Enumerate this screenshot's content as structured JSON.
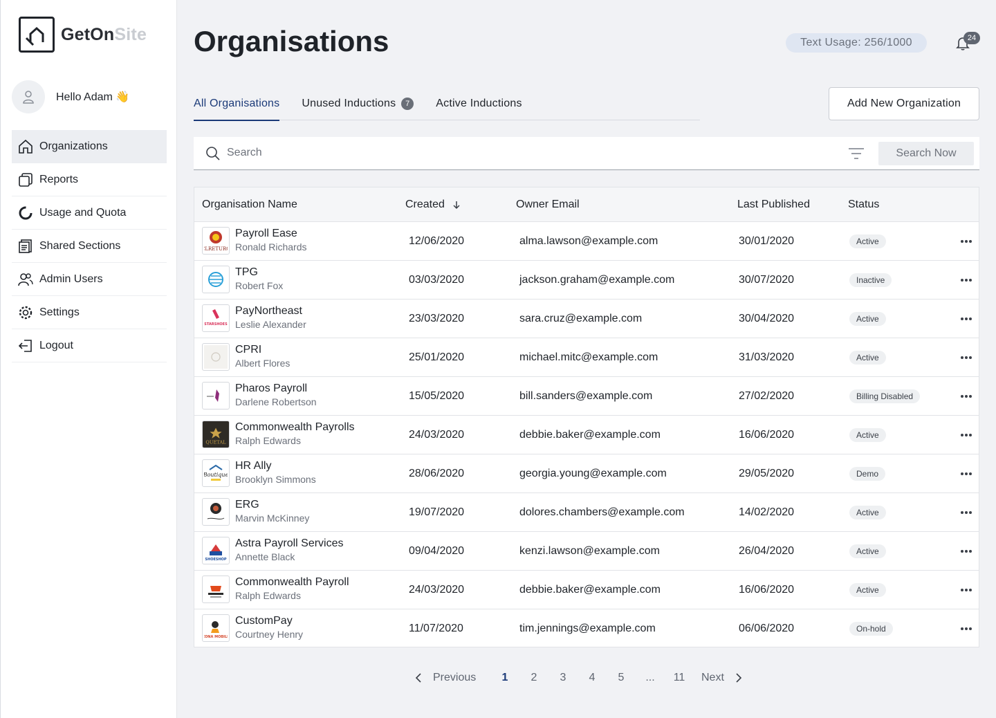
{
  "brand": {
    "part1": "GetOn",
    "part2": "Site"
  },
  "user": {
    "greeting": "Hello Adam 👋"
  },
  "nav": [
    {
      "label": "Organizations",
      "icon": "home-icon",
      "active": true
    },
    {
      "label": "Reports",
      "icon": "reports-icon"
    },
    {
      "label": "Usage and Quota",
      "icon": "usage-icon"
    },
    {
      "label": "Shared Sections",
      "icon": "shared-sections-icon"
    },
    {
      "label": "Admin Users",
      "icon": "admin-users-icon"
    },
    {
      "label": "Settings",
      "icon": "gear-icon"
    },
    {
      "label": "Logout",
      "icon": "logout-icon"
    }
  ],
  "page": {
    "title": "Organisations"
  },
  "usage": {
    "label": "Text Usage: 256/1000"
  },
  "notifications": {
    "count": "24"
  },
  "tabs": [
    {
      "label": "All Organisations",
      "active": true,
      "badge": ""
    },
    {
      "label": "Unused Inductions",
      "badge": "7"
    },
    {
      "label": "Active Inductions",
      "badge": ""
    }
  ],
  "add_button": {
    "label": "Add New Organization"
  },
  "search": {
    "placeholder": "Search",
    "button": "Search Now"
  },
  "table": {
    "headers": {
      "name": "Organisation Name",
      "created": "Created",
      "email": "Owner Email",
      "published": "Last Published",
      "status": "Status"
    },
    "rows": [
      {
        "name": "Payroll Ease",
        "owner": "Ronald Richards",
        "created": "12/06/2020",
        "email": "alma.lawson@example.com",
        "published": "30/01/2020",
        "status": "Active"
      },
      {
        "name": "TPG",
        "owner": "Robert Fox",
        "created": "03/03/2020",
        "email": "jackson.graham@example.com",
        "published": "30/07/2020",
        "status": "Inactive"
      },
      {
        "name": "PayNortheast",
        "owner": "Leslie Alexander",
        "created": "23/03/2020",
        "email": "sara.cruz@example.com",
        "published": "30/04/2020",
        "status": "Active"
      },
      {
        "name": "CPRI",
        "owner": "Albert Flores",
        "created": "25/01/2020",
        "email": "michael.mitc@example.com",
        "published": "31/03/2020",
        "status": "Active"
      },
      {
        "name": "Pharos Payroll",
        "owner": "Darlene Robertson",
        "created": "15/05/2020",
        "email": "bill.sanders@example.com",
        "published": "27/02/2020",
        "status": "Billing Disabled"
      },
      {
        "name": "Commonwealth Payrolls",
        "owner": "Ralph Edwards",
        "created": "24/03/2020",
        "email": "debbie.baker@example.com",
        "published": "16/06/2020",
        "status": "Active"
      },
      {
        "name": "HR Ally",
        "owner": "Brooklyn Simmons",
        "created": "28/06/2020",
        "email": "georgia.young@example.com",
        "published": "29/05/2020",
        "status": "Demo"
      },
      {
        "name": "ERG",
        "owner": "Marvin McKinney",
        "created": "19/07/2020",
        "email": "dolores.chambers@example.com",
        "published": "14/02/2020",
        "status": "Active"
      },
      {
        "name": "Astra Payroll Services",
        "owner": "Annette Black",
        "created": "09/04/2020",
        "email": "kenzi.lawson@example.com",
        "published": "26/04/2020",
        "status": "Active"
      },
      {
        "name": "Commonwealth Payroll",
        "owner": "Ralph Edwards",
        "created": "24/03/2020",
        "email": "debbie.baker@example.com",
        "published": "16/06/2020",
        "status": "Active"
      },
      {
        "name": "CustomPay",
        "owner": "Courtney Henry",
        "created": "11/07/2020",
        "email": "tim.jennings@example.com",
        "published": "06/06/2020",
        "status": "On-hold"
      }
    ]
  },
  "pagination": {
    "previous": "Previous",
    "next": "Next",
    "pages": [
      "1",
      "2",
      "3",
      "4",
      "5",
      "...",
      "11"
    ],
    "current": "1"
  },
  "colors": {
    "accent": "#1b3a78",
    "badge_bg": "#dfe6f2"
  }
}
